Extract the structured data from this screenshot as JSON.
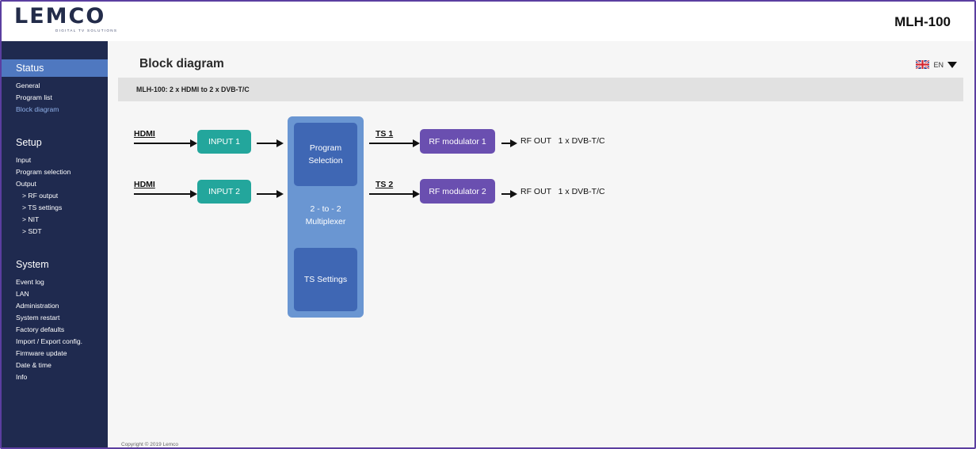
{
  "header": {
    "logo_text": "LEMCO",
    "logo_tagline": "DIGITAL TV SOLUTIONS",
    "model": "MLH-100"
  },
  "sidebar": {
    "sections": [
      {
        "title": "Status",
        "items": [
          {
            "label": "General"
          },
          {
            "label": "Program list"
          },
          {
            "label": "Block diagram"
          }
        ]
      },
      {
        "title": "Setup",
        "items": [
          {
            "label": "Input"
          },
          {
            "label": "Program selection"
          },
          {
            "label": "Output"
          },
          {
            "label": "> RF output"
          },
          {
            "label": "> TS settings"
          },
          {
            "label": "> NIT"
          },
          {
            "label": "> SDT"
          }
        ]
      },
      {
        "title": "System",
        "items": [
          {
            "label": "Event log"
          },
          {
            "label": "LAN"
          },
          {
            "label": "Administration"
          },
          {
            "label": "System restart"
          },
          {
            "label": "Factory defaults"
          },
          {
            "label": "Import / Export config."
          },
          {
            "label": "Firmware update"
          },
          {
            "label": "Date & time"
          },
          {
            "label": "Info"
          }
        ]
      }
    ]
  },
  "main": {
    "title": "Block diagram",
    "language": "EN",
    "subtitle": "MLH-100:   2 x HDMI to 2 x DVB-T/C",
    "copyright": "Copyright © 2019 Lemco"
  },
  "diagram": {
    "input_label": "HDMI",
    "inputs": [
      "INPUT 1",
      "INPUT 2"
    ],
    "mux": {
      "top": "Program Selection",
      "middle_line1": "2 - to - 2",
      "middle_line2": "Multiplexer",
      "bottom": "TS Settings"
    },
    "ts_labels": [
      "TS 1",
      "TS 2"
    ],
    "modulators": [
      "RF modulator 1",
      "RF modulator 2"
    ],
    "outputs": [
      "RF OUT   1 x DVB-T/C",
      "RF OUT   1 x DVB-T/C"
    ]
  },
  "colors": {
    "sidebar_bg": "#1f2a4f",
    "sidebar_active": "#4f78c0",
    "input_box": "#23a69c",
    "modulator_box": "#6a4fb0",
    "mux_outer": "#6a96d2",
    "mux_inner": "#3f67b4",
    "frame_border": "#5b3ea0"
  }
}
